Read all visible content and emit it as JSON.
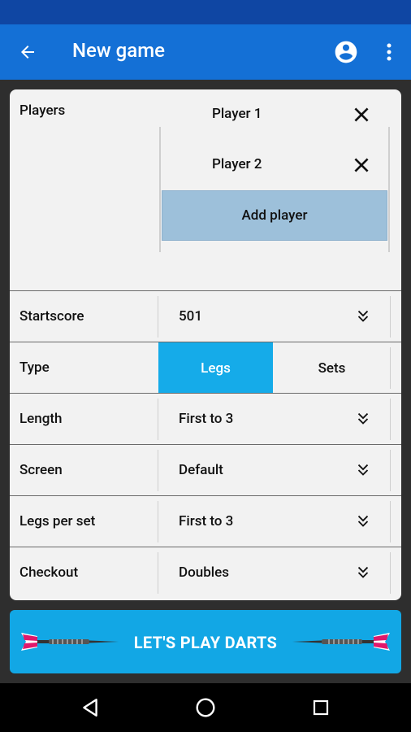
{
  "appbar": {
    "title": "New game"
  },
  "players": {
    "label": "Players",
    "items": [
      {
        "name": "Player 1"
      },
      {
        "name": "Player 2"
      }
    ],
    "add_label": "Add player"
  },
  "settings": {
    "startscore": {
      "label": "Startscore",
      "value": "501"
    },
    "type": {
      "label": "Type",
      "options": [
        "Legs",
        "Sets"
      ],
      "selected": "Legs"
    },
    "length": {
      "label": "Length",
      "value": "First to 3"
    },
    "screen": {
      "label": "Screen",
      "value": "Default"
    },
    "legs_per_set": {
      "label": "Legs per set",
      "value": "First to 3"
    },
    "checkout": {
      "label": "Checkout",
      "value": "Doubles"
    }
  },
  "play_button": {
    "label": "LET'S PLAY DARTS"
  },
  "colors": {
    "appbar": "#1470d6",
    "statusbar": "#0f46a3",
    "accent": "#15abe9",
    "add_player_bg": "#9dc0da"
  },
  "icons": [
    "arrow-back-icon",
    "account-circle-icon",
    "more-vert-icon",
    "close-icon",
    "chevron-double-down-icon",
    "dart-icon",
    "nav-back-icon",
    "nav-home-icon",
    "nav-recents-icon"
  ]
}
